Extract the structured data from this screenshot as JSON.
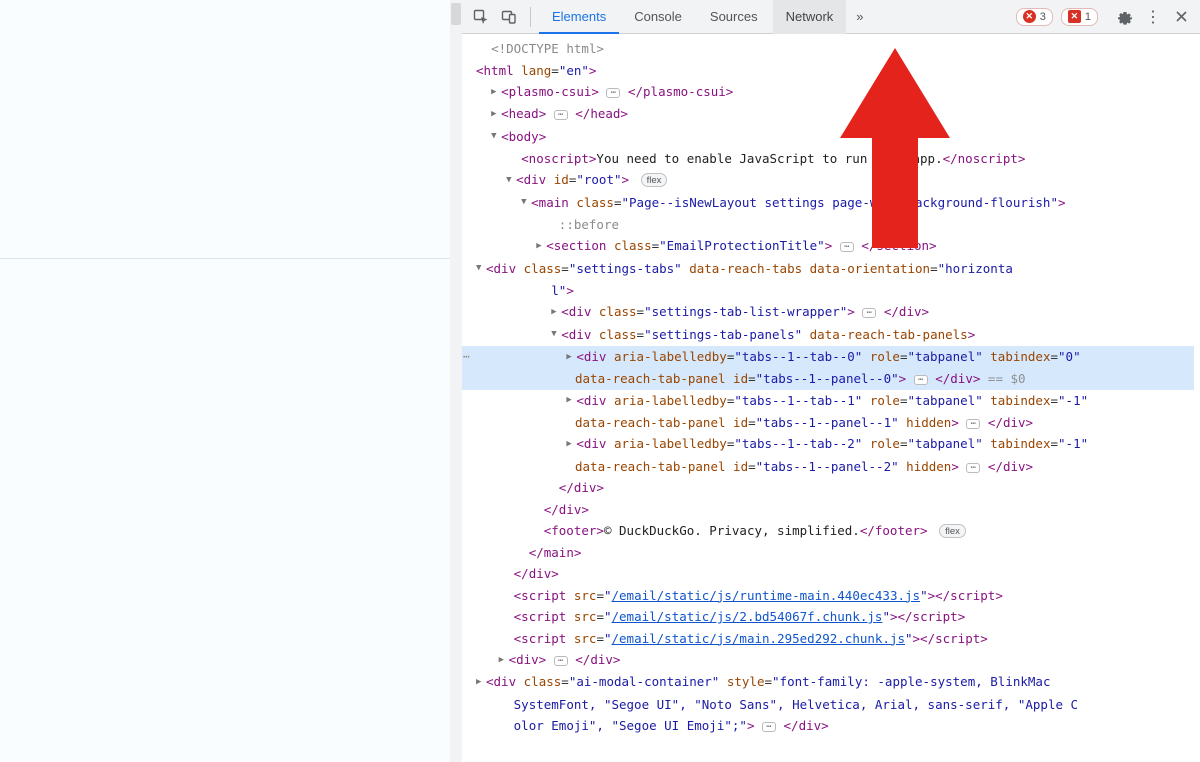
{
  "toolbar": {
    "tabs": {
      "elements": "Elements",
      "console": "Console",
      "sources": "Sources",
      "network": "Network"
    },
    "more": "»",
    "errors": {
      "circle": "3",
      "square": "1"
    }
  },
  "dom": {
    "doctype": "<!DOCTYPE html>",
    "html_open": {
      "tag": "html",
      "attrs": [
        [
          "lang",
          "en"
        ]
      ]
    },
    "plasmo": {
      "tag": "plasmo-csui"
    },
    "head": {
      "tag": "head"
    },
    "body_open": {
      "tag": "body"
    },
    "noscript": {
      "tag": "noscript",
      "text": "You need to enable JavaScript to run this app."
    },
    "root_div": {
      "tag": "div",
      "attrs": [
        [
          "id",
          "root"
        ]
      ],
      "badge": "flex"
    },
    "main": {
      "tag": "main",
      "attrs": [
        [
          "class",
          "Page--isNewLayout settings page-with-background-flourish"
        ]
      ]
    },
    "before": "::before",
    "section": {
      "tag": "section",
      "attrs": [
        [
          "class",
          "EmailProtectionTitle"
        ]
      ]
    },
    "tabs_div": {
      "tag": "div",
      "attrs_text": "class=\"settings-tabs\" data-reach-tabs data-orientation=\"horizontal\""
    },
    "list_wrap": {
      "tag": "div",
      "attrs": [
        [
          "class",
          "settings-tab-list-wrapper"
        ]
      ]
    },
    "panels": {
      "tag": "div",
      "attrs_text": "class=\"settings-tab-panels\" data-reach-tab-panels"
    },
    "panel0": {
      "l1": "aria-labelledby=\"tabs--1--tab--0\" role=\"tabpanel\" tabindex=\"0\"",
      "l2": "data-reach-tab-panel id=\"tabs--1--panel--0\""
    },
    "panel1": {
      "l1": "aria-labelledby=\"tabs--1--tab--1\" role=\"tabpanel\" tabindex=\"-1\"",
      "l2": "data-reach-tab-panel id=\"tabs--1--panel--1\" hidden"
    },
    "panel2": {
      "l1": "aria-labelledby=\"tabs--1--tab--2\" role=\"tabpanel\" tabindex=\"-1\"",
      "l2": "data-reach-tab-panel id=\"tabs--1--panel--2\" hidden"
    },
    "footer": {
      "tag": "footer",
      "text": "© DuckDuckGo. Privacy, simplified.",
      "badge": "flex"
    },
    "scripts": [
      "/email/static/js/runtime-main.440ec433.js",
      "/email/static/js/2.bd54067f.chunk.js",
      "/email/static/js/main.295ed292.chunk.js"
    ],
    "stray_div": {
      "tag": "div"
    },
    "ai_modal": {
      "text": "class=\"ai-modal-container\" style=\"font-family: -apple-system, BlinkMacSystemFont, \"Segoe UI\", \"Noto Sans\", Helvetica, Arial, sans-serif, \"Apple Color Emoji\", \"Segoe UI Emoji\";\""
    },
    "close_div": "</div>",
    "close_main": "</main>",
    "close_body_div": "</div>",
    "eq0": " == $0"
  }
}
